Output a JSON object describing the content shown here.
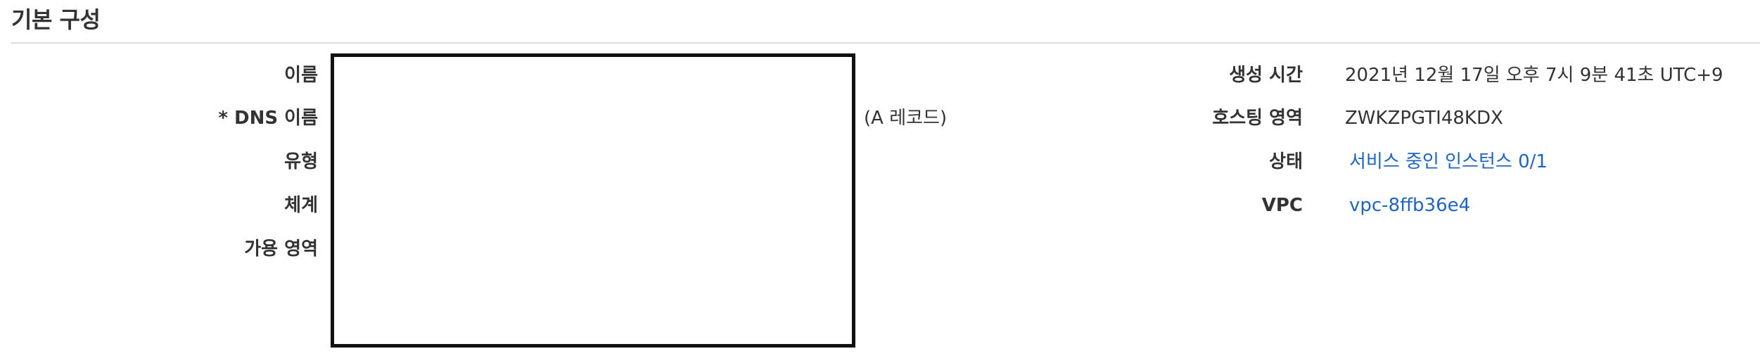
{
  "section": {
    "title": "기본 구성"
  },
  "left_fields": {
    "name_label": "이름",
    "dns_label": "* DNS 이름",
    "type_label": "유형",
    "scheme_label": "체계",
    "az_label": "가용 영역",
    "dns_record_note": "(A 레코드)"
  },
  "right_fields": {
    "created_label": "생성 시간",
    "created_value": "2021년 12월 17일 오후 7시 9분 41초 UTC+9",
    "hosted_zone_label": "호스팅 영역",
    "hosted_zone_value": "ZWKZPGTI48KDX",
    "status_label": "상태",
    "status_value": "서비스 중인 인스턴스 0/1",
    "vpc_label": "VPC",
    "vpc_value": "vpc-8ffb36e4"
  },
  "colors": {
    "link": "#1f64c4",
    "text": "#333333",
    "divider": "#dcdcdc",
    "redaction_border": "#111111"
  }
}
